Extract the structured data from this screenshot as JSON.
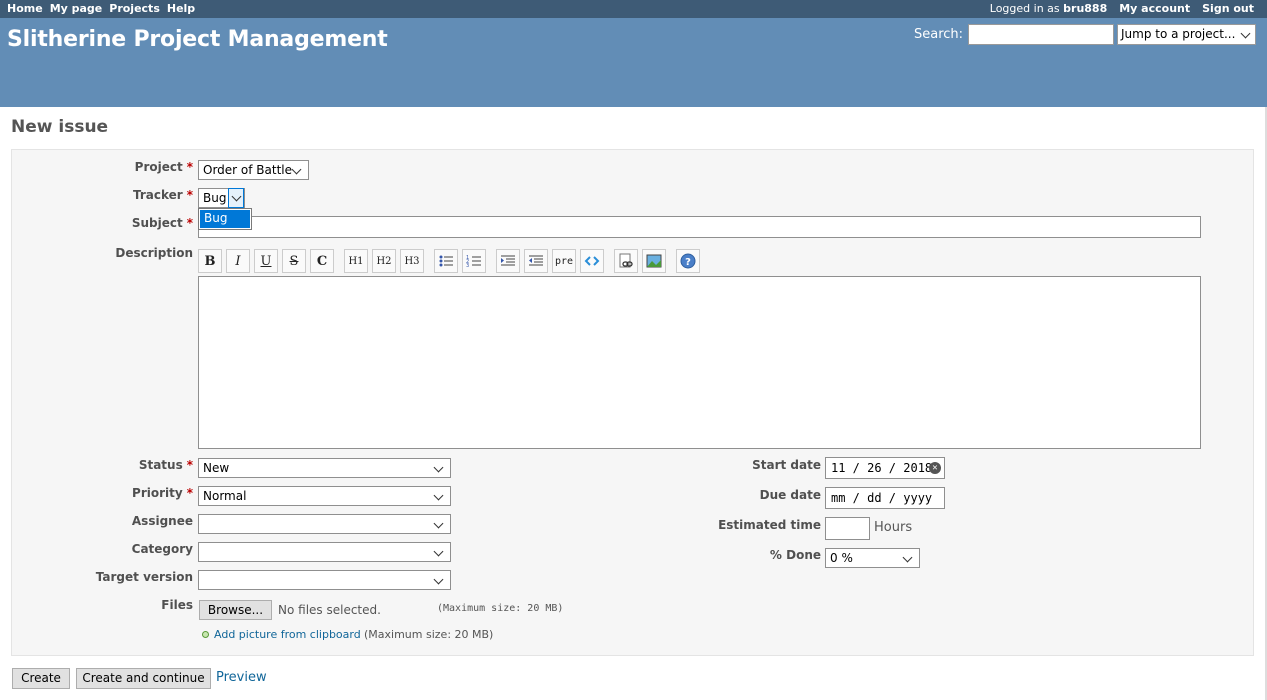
{
  "top_menu": {
    "home": "Home",
    "my_page": "My page",
    "projects": "Projects",
    "help": "Help",
    "logged_in_prefix": "Logged in as",
    "username": "bru888",
    "my_account": "My account",
    "sign_out": "Sign out"
  },
  "header": {
    "title": "Slitherine Project Management",
    "search_label": "Search:",
    "jump_label": "Jump to a project..."
  },
  "page": {
    "title": "New issue"
  },
  "form": {
    "project_label": "Project",
    "project_value": "Order of Battle",
    "tracker_label": "Tracker",
    "tracker_value": "Bug",
    "tracker_options": [
      "Bug"
    ],
    "subject_label": "Subject",
    "description_label": "Description",
    "toolbar": {
      "bold": "B",
      "italic": "I",
      "underline": "U",
      "strike": "S",
      "code": "C",
      "h1": "H1",
      "h2": "H2",
      "h3": "H3",
      "pre": "pre"
    },
    "status_label": "Status",
    "status_value": "New",
    "priority_label": "Priority",
    "priority_value": "Normal",
    "assignee_label": "Assignee",
    "assignee_value": "",
    "category_label": "Category",
    "category_value": "",
    "target_label": "Target version",
    "target_value": "",
    "files_label": "Files",
    "browse_label": "Browse...",
    "no_files": "No files selected.",
    "max_size": "(Maximum size: 20 MB)",
    "add_picture": "Add picture from clipboard",
    "max_size_2": "(Maximum size: 20 MB)",
    "start_label": "Start date",
    "start_value": "11 / 26 / 2018",
    "due_label": "Due date",
    "due_value": "mm / dd / yyyy",
    "estimated_label": "Estimated time",
    "hours": "Hours",
    "done_label": "% Done",
    "done_value": "0 %"
  },
  "actions": {
    "create": "Create",
    "create_continue": "Create and continue",
    "preview": "Preview"
  },
  "colors": {
    "top_menu": "#3e5b76",
    "header": "#628db6",
    "required": "#bb0000",
    "link": "#116699"
  }
}
